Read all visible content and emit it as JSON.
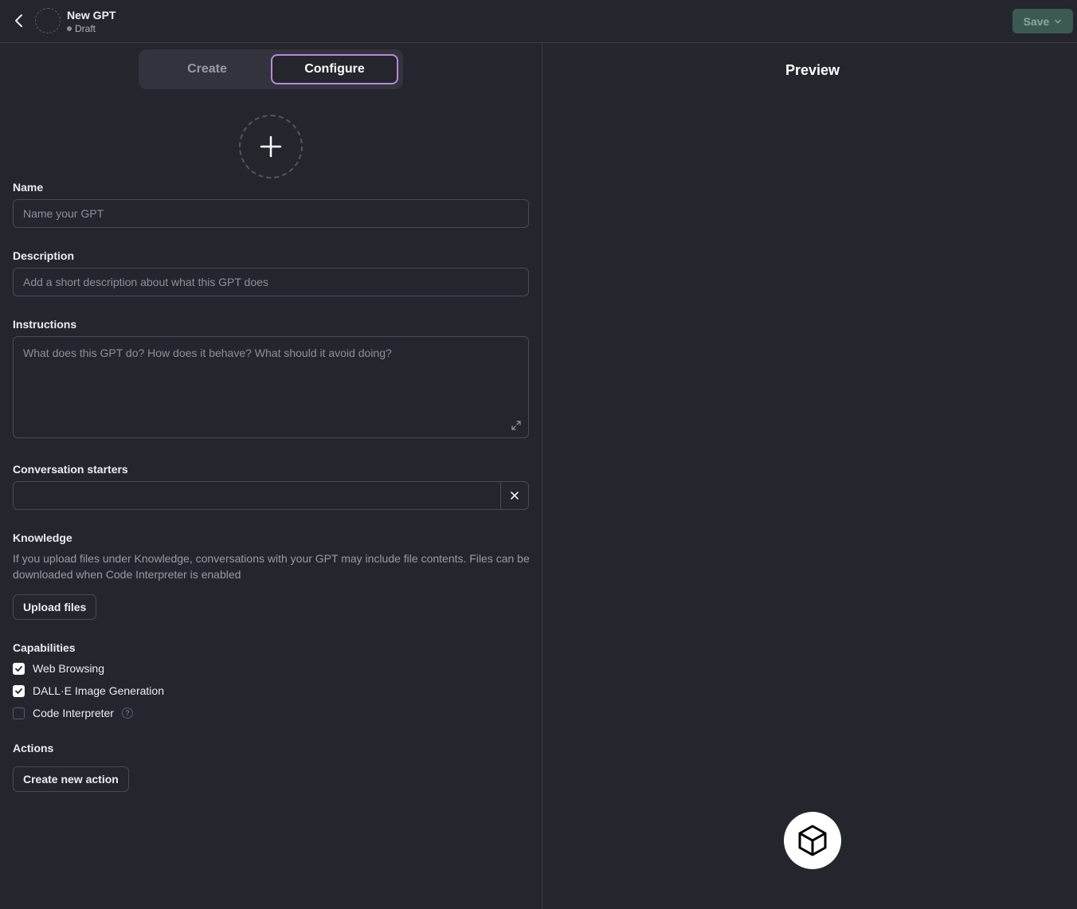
{
  "header": {
    "title": "New GPT",
    "status": "Draft",
    "save_label": "Save"
  },
  "tabs": [
    {
      "label": "Create",
      "active": false
    },
    {
      "label": "Configure",
      "active": true
    }
  ],
  "form": {
    "name": {
      "label": "Name",
      "placeholder": "Name your GPT",
      "value": ""
    },
    "description": {
      "label": "Description",
      "placeholder": "Add a short description about what this GPT does",
      "value": ""
    },
    "instructions": {
      "label": "Instructions",
      "placeholder": "What does this GPT do? How does it behave? What should it avoid doing?",
      "value": ""
    },
    "conversation_starters": {
      "label": "Conversation starters",
      "value": ""
    },
    "knowledge": {
      "label": "Knowledge",
      "help": "If you upload files under Knowledge, conversations with your GPT may include file contents. Files can be downloaded when Code Interpreter is enabled",
      "upload_label": "Upload files"
    },
    "capabilities": {
      "label": "Capabilities",
      "items": [
        {
          "label": "Web Browsing",
          "checked": true
        },
        {
          "label": "DALL·E Image Generation",
          "checked": true
        },
        {
          "label": "Code Interpreter",
          "checked": false,
          "help_icon": "?"
        }
      ]
    },
    "actions": {
      "label": "Actions",
      "create_label": "Create new action"
    }
  },
  "preview": {
    "title": "Preview",
    "icon": "cube-icon"
  },
  "colors": {
    "background": "#25252e",
    "accent_border": "#b789d8",
    "save_button": "#3c5a52"
  }
}
